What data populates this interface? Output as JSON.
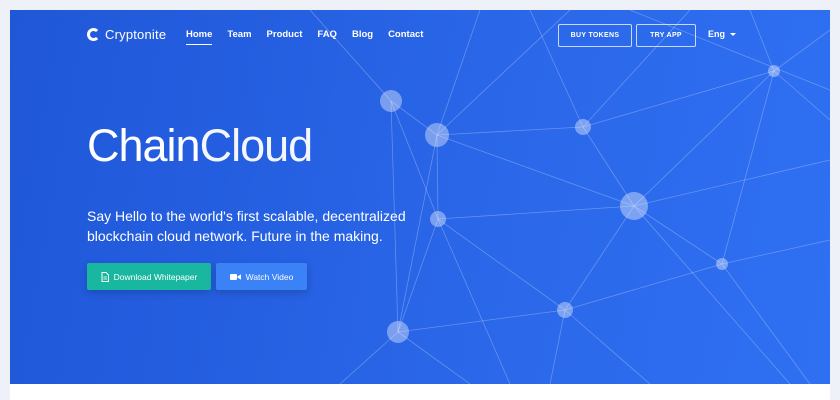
{
  "brand": {
    "name": "Cryptonite",
    "icon": "c-logo-icon"
  },
  "nav": {
    "items": [
      {
        "label": "Home",
        "active": true
      },
      {
        "label": "Team",
        "active": false
      },
      {
        "label": "Product",
        "active": false
      },
      {
        "label": "FAQ",
        "active": false
      },
      {
        "label": "Blog",
        "active": false
      },
      {
        "label": "Contact",
        "active": false
      }
    ],
    "buy_tokens": "BUY TOKENS",
    "try_app": "TRY APP",
    "language": "Eng"
  },
  "hero": {
    "title_part1": "Chain",
    "title_part2": "Cloud",
    "subtitle": "Say Hello to the world's first scalable, decentralized blockchain cloud network. Future in the making.",
    "download_label": "Download Whitepaper",
    "download_icon": "document-icon",
    "video_label": "Watch Video",
    "video_icon": "video-camera-icon"
  },
  "colors": {
    "background_start": "#1f57d8",
    "background_end": "#2f70f2",
    "download_button": "#19b79f",
    "video_button": "#3b82f7"
  }
}
